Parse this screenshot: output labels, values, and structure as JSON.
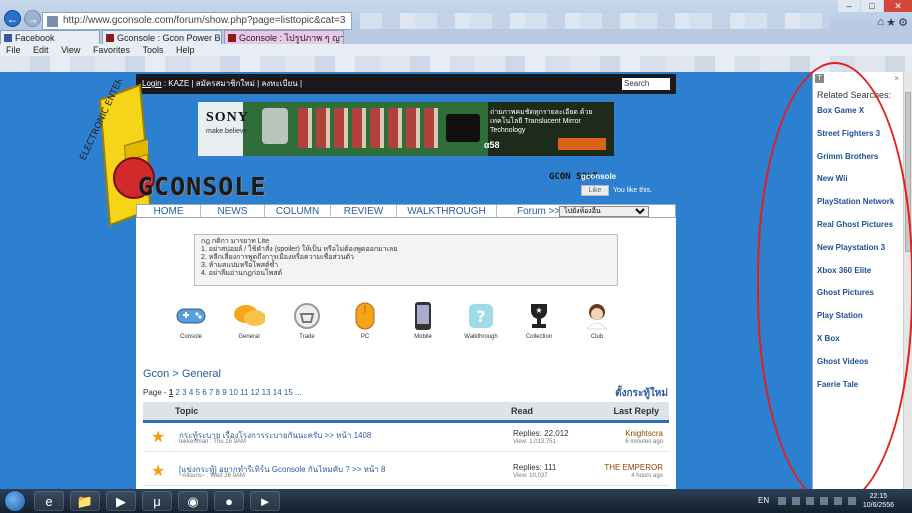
{
  "browser": {
    "address": "http://www.gconsole.com/forum/show.php?page=listtopic&cat=3",
    "tabs": [
      {
        "label": "Facebook"
      },
      {
        "label": "Gconsole : Gcon Power Boa..."
      },
      {
        "label": "Gconsole : ไปรูปภาพ ๆ ญาพา Roo..."
      }
    ],
    "menu": [
      "File",
      "Edit",
      "View",
      "Favorites",
      "Tools",
      "Help"
    ]
  },
  "site": {
    "topbar": {
      "login": "Login",
      "user": ": KAZE",
      "rest": "| สมัครสมาชิกใหม่ | ลงทะเบียน |",
      "search_placeholder": "Search"
    },
    "logo_text": "GCONSOLE",
    "banner": {
      "brand": "SONY",
      "tagline": "make.believe",
      "thai": "ถ่ายภาพคมชัดทุกรายละเอียด ด้วยเทคโนโลยี Translucent Mirror Technology",
      "model": "α58"
    },
    "social": {
      "logo": "GCON SOLE",
      "name": "gconsole",
      "like": "Like",
      "likes_text": "You like this."
    },
    "nav": {
      "items": [
        "HOME",
        "NEWS",
        "COLUMN",
        "REVIEW",
        "WALKTHROUGH"
      ],
      "forum_label": "Forum >>",
      "forum_select": "ไปยังห้องอื่น"
    },
    "rules": [
      "กฎ กติกา มารยาท Lite",
      "1. อย่าสปอยล์ / ใช้คำสั่ง (spoiler) ให้เป็น หรือไม่ต้องพูดออกมาเลย",
      "2. หลีกเลี่ยงการพูดถึงการเมืองหรือความเชื่อส่วนตัว",
      "3. ห้ามสแปมหรือโพสต์ซ้ำ",
      "4. อย่าลืมอ่านกฎก่อนโพสต์"
    ],
    "categories": [
      {
        "label": "Console",
        "icon": "gamepad-icon"
      },
      {
        "label": "General",
        "icon": "speech-bubbles-icon"
      },
      {
        "label": "Trade",
        "icon": "basket-icon"
      },
      {
        "label": "PC",
        "icon": "mouse-icon"
      },
      {
        "label": "Mobile",
        "icon": "phone-icon"
      },
      {
        "label": "Walkthrough",
        "icon": "question-icon"
      },
      {
        "label": "Collection",
        "icon": "trophy-icon"
      },
      {
        "label": "Club",
        "icon": "girl-avatar-icon"
      }
    ],
    "breadcrumb": "Gcon > General",
    "pager": {
      "prefix": "Page -",
      "current": "1",
      "links": "2 3 4 5 6 7 8 9 10 11 12 13 14 15 ..."
    },
    "new_topic": "ตั้งกระทู้ใหม่",
    "table": {
      "headers": {
        "topic": "Topic",
        "read": "Read",
        "last": "Last Reply"
      },
      "rows": [
        {
          "title": "กระทู้ระบาย เรื่องโรงการระบายกันนะครับ >> หน้า 1408",
          "meta": "tekkenman : Thu 16 9AM",
          "replies": "Replies: 22,012",
          "views": "View: 1,013,751",
          "last_user": "Knightscra",
          "ago": "6 minutes ago"
        },
        {
          "title": "[แข่งกระทู้] อยากทำรีเทิร์น Gconsole กันไหมคับ ? >> หน้า 8",
          "meta": "~Allsuns~ : Wed 26 9AM",
          "replies": "Replies: 111",
          "views": "View: 10,037",
          "last_user": "THE EMPEROR",
          "ago": "4 hours ago"
        }
      ]
    }
  },
  "related": {
    "title": "Related Searches:",
    "items": [
      "Box Game X",
      "Street Fighters 3",
      "Grimm Brothers",
      "New Wii",
      "PlayStation Network",
      "Real Ghost Pictures",
      "New Playstation 3",
      "Xbox 360 Elite",
      "Ghost Pictures",
      "Play Station",
      "X Box",
      "Ghost Videos",
      "Faerie Tale"
    ]
  },
  "taskbar": {
    "lang": "EN",
    "time": "22:15",
    "date": "10/6/2556"
  },
  "colors": {
    "page_bg": "#2d7fcf",
    "link": "#2a5d9a",
    "highlight_circle": "#e21f1f",
    "star": "#f0a10a"
  }
}
